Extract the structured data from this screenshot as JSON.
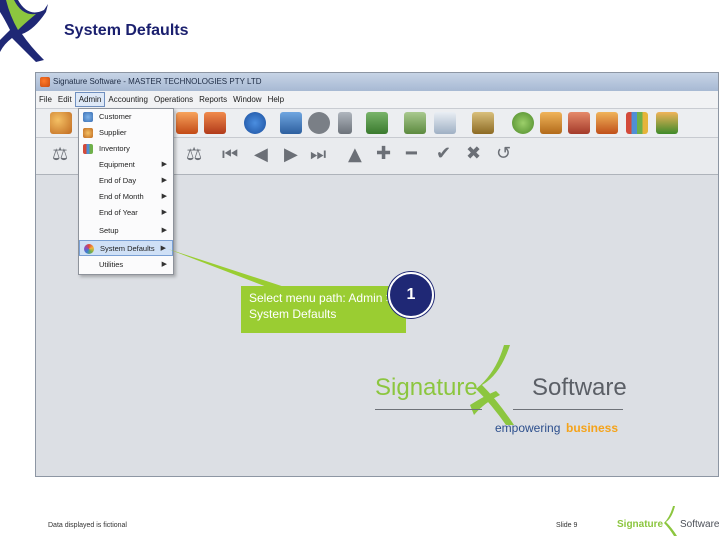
{
  "slide": {
    "title": "System Defaults",
    "footer_note": "Data displayed is fictional",
    "slide_number": "Slide 9",
    "footer_logo_left": "Signature",
    "footer_logo_right": "Software"
  },
  "window": {
    "title": "Signature Software - MASTER TECHNOLOGIES PTY LTD"
  },
  "menubar": [
    "File",
    "Edit",
    "Admin",
    "Accounting",
    "Operations",
    "Reports",
    "Window",
    "Help"
  ],
  "admin_menu": {
    "items": [
      {
        "label": "Customer",
        "icon": "customer-icon",
        "submenu": false
      },
      {
        "label": "Supplier",
        "icon": "supplier-icon",
        "submenu": false
      },
      {
        "label": "Inventory",
        "icon": "inventory-icon",
        "submenu": false
      },
      {
        "label": "Equipment",
        "icon": "",
        "submenu": true
      },
      {
        "label": "End of Day",
        "icon": "",
        "submenu": true
      },
      {
        "label": "End of Month",
        "icon": "",
        "submenu": true
      },
      {
        "label": "End of Year",
        "icon": "",
        "submenu": true
      },
      {
        "label": "Setup",
        "icon": "",
        "submenu": true
      },
      {
        "label": "System Defaults",
        "icon": "system-defaults-icon",
        "submenu": true,
        "selected": true
      },
      {
        "label": "Utilities",
        "icon": "",
        "submenu": true
      }
    ]
  },
  "callout": {
    "text": "Select menu path: Admin > System Defaults",
    "step": "1",
    "color": "#9acd32"
  },
  "branding": {
    "left": "Signature",
    "right": "Software",
    "tagline_a": "empowering",
    "tagline_b": "business",
    "green": "#8cc63f"
  },
  "toolbar2_icons": [
    "bookmark-icon",
    "first-record-icon",
    "previous-record-icon",
    "next-record-icon",
    "last-record-icon",
    "move-up-icon",
    "add-icon",
    "remove-icon",
    "confirm-icon",
    "cancel-icon",
    "refresh-icon"
  ]
}
